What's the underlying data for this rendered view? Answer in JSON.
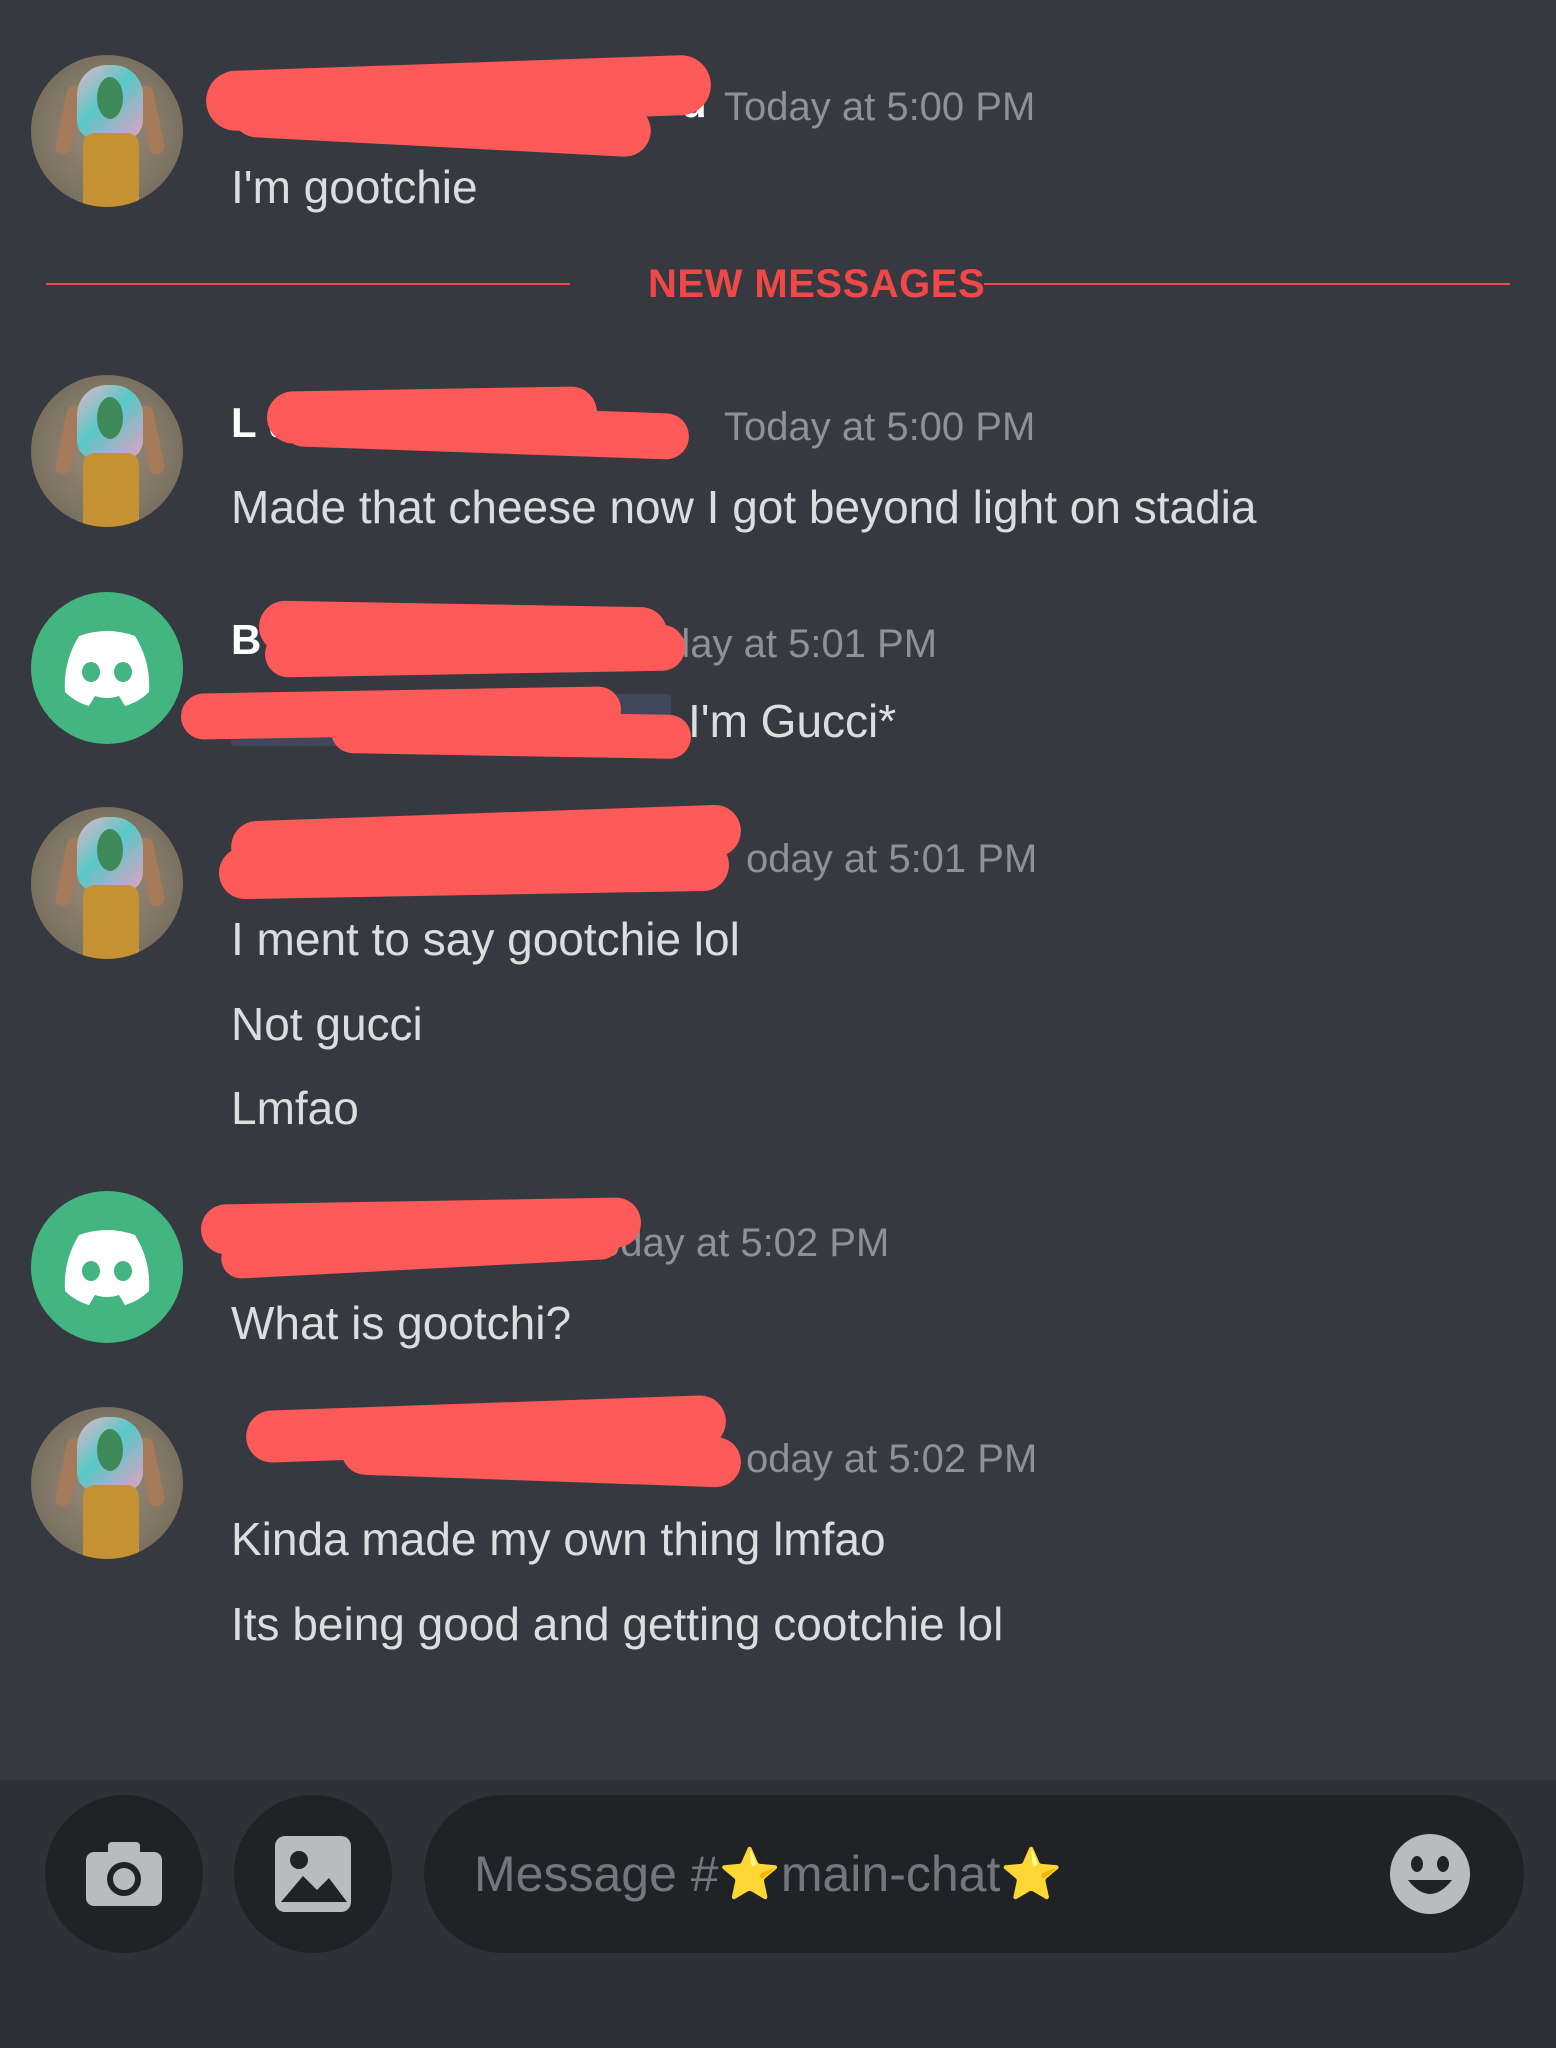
{
  "colors": {
    "background": "#36393f",
    "composer_bg": "#2f3136",
    "input_bg": "#202225",
    "text": "#dcddde",
    "username": "#ffffff",
    "timestamp": "#8e9297",
    "new_messages": "#f04747",
    "discord_green": "#43b581",
    "redaction": "#ff5a5a"
  },
  "divider": {
    "label": "NEW MESSAGES"
  },
  "messages": [
    {
      "avatar": "photo-avatar",
      "username_visible": "u",
      "timestamp": "Today at 5:00 PM",
      "lines": [
        "I'm gootchie"
      ]
    },
    {
      "avatar": "photo-avatar",
      "username_visible": "L                u",
      "timestamp": "Today at 5:00 PM",
      "lines": [
        "Made that cheese now I got beyond light on stadia"
      ]
    },
    {
      "avatar": "discord-logo-avatar",
      "username_visible": "B",
      "timestamp": "day at 5:01 PM",
      "lines": [
        "I'm Gucci*"
      ]
    },
    {
      "avatar": "photo-avatar",
      "username_visible": "",
      "timestamp": "oday at 5:01 PM",
      "lines": [
        "I ment to say gootchie lol",
        "Not gucci",
        "Lmfao"
      ]
    },
    {
      "avatar": "discord-logo-avatar",
      "username_visible": "e",
      "timestamp": "oday at 5:02 PM",
      "lines": [
        "What is gootchi?"
      ]
    },
    {
      "avatar": "photo-avatar",
      "username_visible": "",
      "timestamp": "oday at 5:02 PM",
      "lines": [
        "Kinda made my own thing lmfao",
        "Its being good and getting cootchie lol"
      ]
    }
  ],
  "composer": {
    "camera_icon": "camera-icon",
    "gallery_icon": "image-icon",
    "placeholder": "Message #⭐main-chat⭐",
    "emoji_icon": "emoji-smile-icon"
  }
}
